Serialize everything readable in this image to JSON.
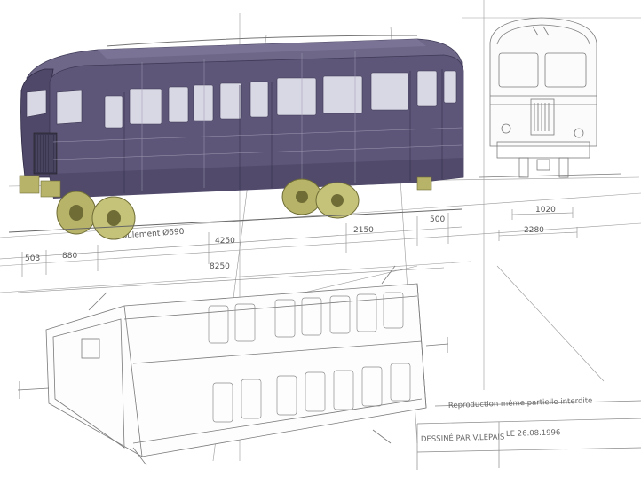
{
  "dimensions": {
    "wheel_diameter": "Roulement Ø690",
    "d_4250": "4250",
    "d_2150": "2150",
    "d_500": "500",
    "d_503": "503",
    "d_880": "880",
    "d_8250": "8250",
    "d_1020": "1020",
    "d_2280": "2280"
  },
  "title_block": {
    "reproduction_notice": "Reproduction même partielle interdite",
    "drawn_by": "DESSINÉ PAR V.LEPAIS",
    "date": "LE 26.08.1996"
  },
  "colors": {
    "body": "#5e5678",
    "body_dark": "#3f3a57",
    "roof": "#6e6788",
    "window": "#d8d8e4",
    "wheel": "#b7b46a",
    "wheel_dark": "#6f6d35",
    "line": "#8a8a8a"
  }
}
